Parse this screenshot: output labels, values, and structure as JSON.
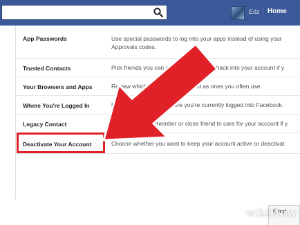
{
  "header": {
    "user_name": "Edz",
    "home_label": "Home"
  },
  "settings_rows": [
    {
      "label": "App Passwords",
      "desc_line1": "Use special passwords to log into your apps instead of using your",
      "desc_line2": "Approvals codes."
    },
    {
      "label": "Trusted Contacts",
      "desc_line1": "Pick friends you can call to help you get back into your account if y"
    },
    {
      "label": "Your Browsers and Apps",
      "desc_line1": "Review which browsers you saved as ones you often use."
    },
    {
      "label": "Where You're Logged In",
      "desc_line1": "Review and manage where you're currently logged into Facebook."
    },
    {
      "label": "Legacy Contact",
      "desc_line1": "Choose a family member or close friend to care for your account if y"
    },
    {
      "label": "Deactivate Your Account",
      "desc_line1": "Choose whether you want to keep your account active or deactivat"
    }
  ],
  "chat": {
    "label": "Chat"
  },
  "watermark": {
    "prefix": "wiki",
    "suffix": "How"
  },
  "colors": {
    "topbar": "#3b5998",
    "arrow": "#e02127",
    "highlight": "#e02127"
  }
}
